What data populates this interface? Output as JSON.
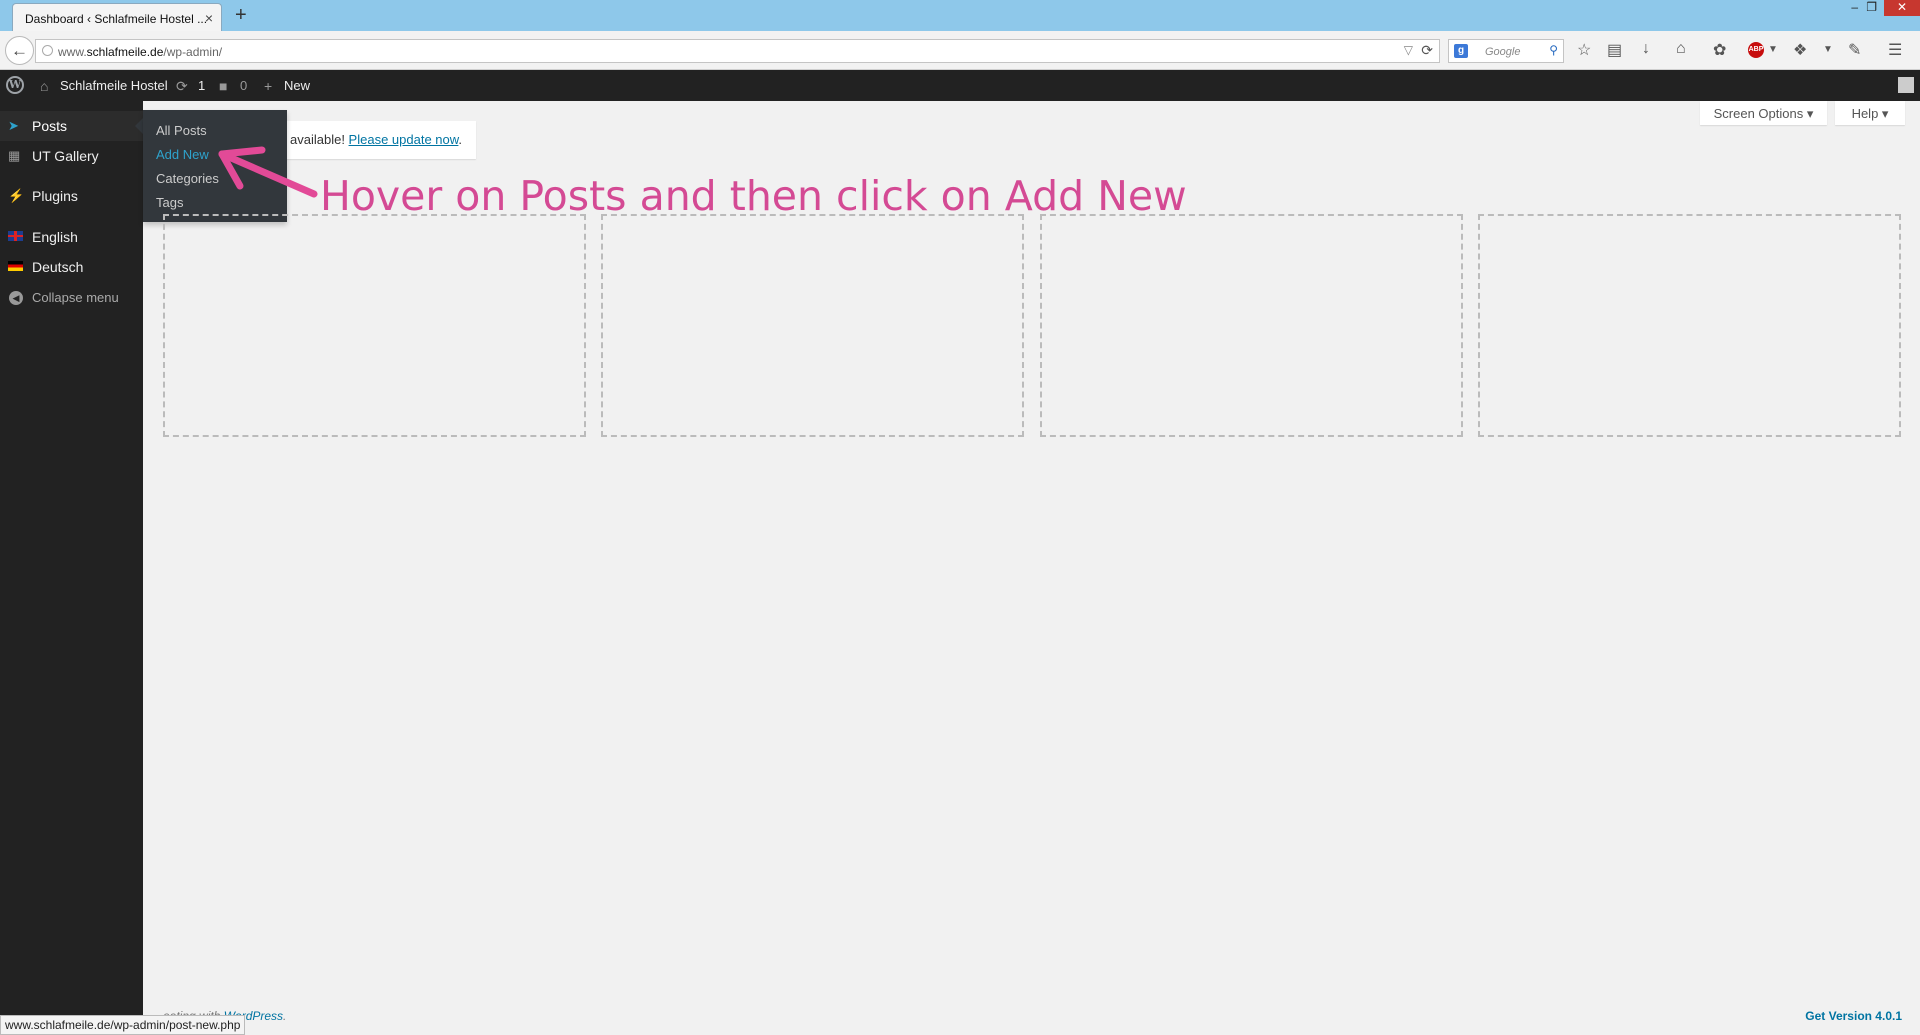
{
  "browser": {
    "tab_title": "Dashboard ‹ Schlafmeile Hostel ...",
    "tab_close": "×",
    "new_tab": "+",
    "url_prefix": "www.",
    "url_host": "schlafmeile.de",
    "url_path": "/wp-admin/",
    "search_placeholder": "Google",
    "search_engine_icon": "g-icon",
    "window_controls": [
      "–",
      "❐",
      "✕"
    ]
  },
  "adminbar": {
    "site_name": "Schlafmeile Hostel",
    "updates_count": "1",
    "comments_count": "0",
    "new_label": "New"
  },
  "sidebar": {
    "items": [
      {
        "label": "Posts",
        "icon": "pin-icon"
      },
      {
        "label": "UT Gallery",
        "icon": "folder-icon"
      },
      {
        "label": "Plugins",
        "icon": "plugin-icon"
      },
      {
        "label": "English",
        "icon": "uk-flag-icon"
      },
      {
        "label": "Deutsch",
        "icon": "de-flag-icon"
      },
      {
        "label": "Collapse menu",
        "icon": "collapse-icon"
      }
    ]
  },
  "flyout": {
    "items": [
      "All Posts",
      "Add New",
      "Categories",
      "Tags"
    ],
    "active_index": 1
  },
  "notice": {
    "text": "available! ",
    "link": "Please update now",
    "end": "."
  },
  "toolbar": {
    "screen_options": "Screen Options ▾",
    "help": "Help ▾"
  },
  "annotation": {
    "text": "Hover on Posts and then click on Add New",
    "color": "#d44a94"
  },
  "footer": {
    "text_before": "eating with ",
    "link": "WordPress",
    "text_after": ".",
    "version": "Get Version 4.0.1"
  },
  "status_url": "www.schlafmeile.de/wp-admin/post-new.php",
  "colors": {
    "admin_dark": "#222222",
    "accent_blue": "#2ea2cc",
    "link_blue": "#0074a2"
  }
}
